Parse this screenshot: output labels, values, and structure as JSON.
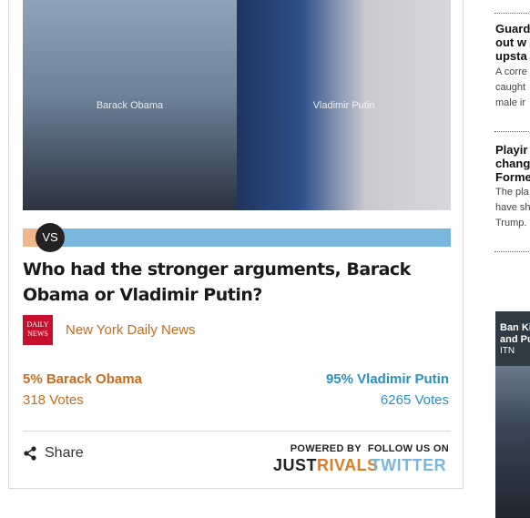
{
  "poll": {
    "image_left_alt": "Barack Obama",
    "image_right_alt": "Vladimir Putin",
    "vs_label": "VS",
    "question": "Who had the stronger arguments, Barack Obama or Vladimir Putin?",
    "source": {
      "logo_text": "DAILY NEWS",
      "name": "New York Daily News"
    },
    "option_a": {
      "label": "5% Barack Obama",
      "votes": "318 Votes",
      "percent": 5,
      "color": "#c96a1e"
    },
    "option_b": {
      "label": "95% Vladimir Putin",
      "votes": "6265 Votes",
      "percent": 95,
      "color": "#2b8fc6"
    },
    "share_label": "Share",
    "powered_by_label": "POWERED BY",
    "brand_part1": "JUST",
    "brand_part2": "RIVALS",
    "follow_label": "FOLLOW US ON",
    "twitter_label": "TWITTER"
  },
  "sidebar": {
    "story1": {
      "title_lines": [
        "Guard",
        "out w",
        "upsta"
      ],
      "snippet_lines": [
        "A corre",
        "caught",
        "male ir"
      ]
    },
    "story2": {
      "title_lines": [
        "Playir",
        "chang",
        "Forme"
      ],
      "snippet_lines": [
        "The pla",
        "have sh",
        "Trump."
      ]
    },
    "video": {
      "title_lines": [
        "Ban Ki",
        "and Pu"
      ],
      "source": "ITN"
    }
  }
}
